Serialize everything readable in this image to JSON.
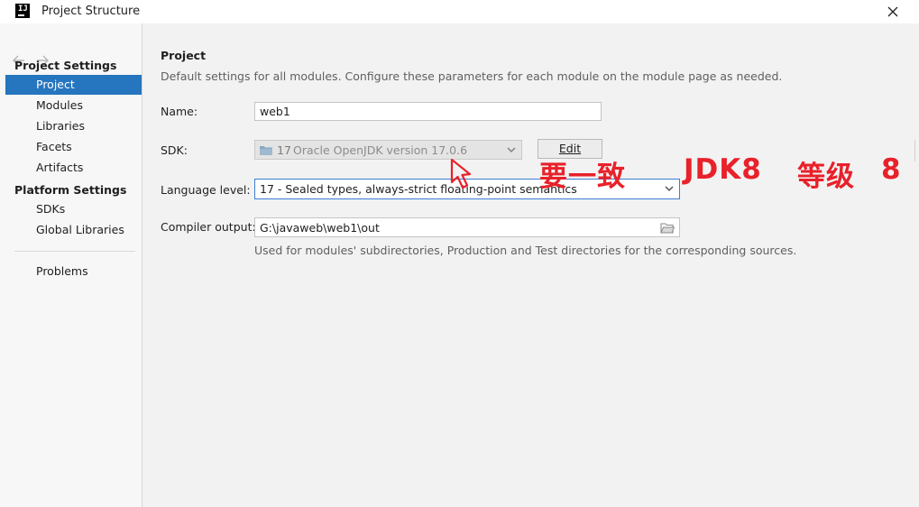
{
  "window": {
    "title": "Project Structure",
    "logo_text": "IJ"
  },
  "sidebar": {
    "project_settings_header": "Project Settings",
    "project_items": [
      "Project",
      "Modules",
      "Libraries",
      "Facets",
      "Artifacts"
    ],
    "platform_settings_header": "Platform Settings",
    "platform_items": [
      "SDKs",
      "Global Libraries"
    ],
    "problems": "Problems",
    "selected": "Project"
  },
  "main": {
    "title": "Project",
    "description": "Default settings for all modules. Configure these parameters for each module on the module page as needed.",
    "name": {
      "label": "Name:",
      "value": "web1"
    },
    "sdk": {
      "label": "SDK:",
      "version_number": "17",
      "version_text": "Oracle OpenJDK version 17.0.6",
      "edit_label": "Edit"
    },
    "language_level": {
      "label": "Language level:",
      "value": "17 - Sealed types, always-strict floating-point semantics"
    },
    "compiler_output": {
      "label": "Compiler output:",
      "value": "G:\\javaweb\\web1\\out",
      "hint": "Used for modules' subdirectories, Production and Test directories for the corresponding sources."
    }
  },
  "annotation": {
    "part1": "要一致",
    "part2": "JDK8",
    "part3": "等级",
    "part4": "8",
    "color": "#e8212a"
  },
  "colors": {
    "accent": "#2675bf",
    "focus_border": "#3c7ed1",
    "background": "#f2f2f2"
  }
}
